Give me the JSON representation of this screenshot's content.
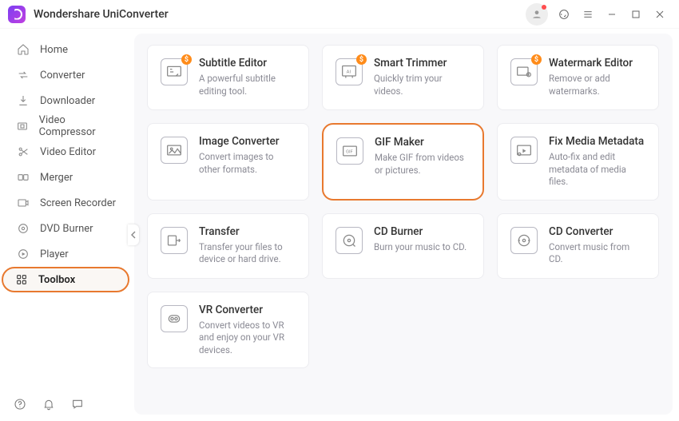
{
  "app": {
    "title": "Wondershare UniConverter"
  },
  "sidebar": {
    "items": [
      {
        "label": "Home",
        "icon": "home"
      },
      {
        "label": "Converter",
        "icon": "converter"
      },
      {
        "label": "Downloader",
        "icon": "download"
      },
      {
        "label": "Video Compressor",
        "icon": "compress"
      },
      {
        "label": "Video Editor",
        "icon": "scissors"
      },
      {
        "label": "Merger",
        "icon": "merge"
      },
      {
        "label": "Screen Recorder",
        "icon": "record"
      },
      {
        "label": "DVD Burner",
        "icon": "disc"
      },
      {
        "label": "Player",
        "icon": "play"
      },
      {
        "label": "Toolbox",
        "icon": "grid"
      }
    ],
    "active_index": 9
  },
  "tools": [
    {
      "title": "Subtitle Editor",
      "desc": "A powerful subtitle editing tool.",
      "badge": "$",
      "highlight": false
    },
    {
      "title": "Smart Trimmer",
      "desc": "Quickly trim your videos.",
      "badge": "$",
      "highlight": false
    },
    {
      "title": "Watermark Editor",
      "desc": "Remove or add watermarks.",
      "badge": "$",
      "highlight": false
    },
    {
      "title": "Image Converter",
      "desc": "Convert images to other formats.",
      "badge": null,
      "highlight": false
    },
    {
      "title": "GIF Maker",
      "desc": "Make GIF from videos or pictures.",
      "badge": null,
      "highlight": true
    },
    {
      "title": "Fix Media Metadata",
      "desc": "Auto-fix and edit metadata of media files.",
      "badge": null,
      "highlight": false
    },
    {
      "title": "Transfer",
      "desc": "Transfer your files to device or hard drive.",
      "badge": null,
      "highlight": false
    },
    {
      "title": "CD Burner",
      "desc": "Burn your music to CD.",
      "badge": null,
      "highlight": false
    },
    {
      "title": "CD Converter",
      "desc": "Convert music from CD.",
      "badge": null,
      "highlight": false
    },
    {
      "title": "VR Converter",
      "desc": "Convert videos to VR and enjoy on your VR devices.",
      "badge": null,
      "highlight": false
    }
  ]
}
